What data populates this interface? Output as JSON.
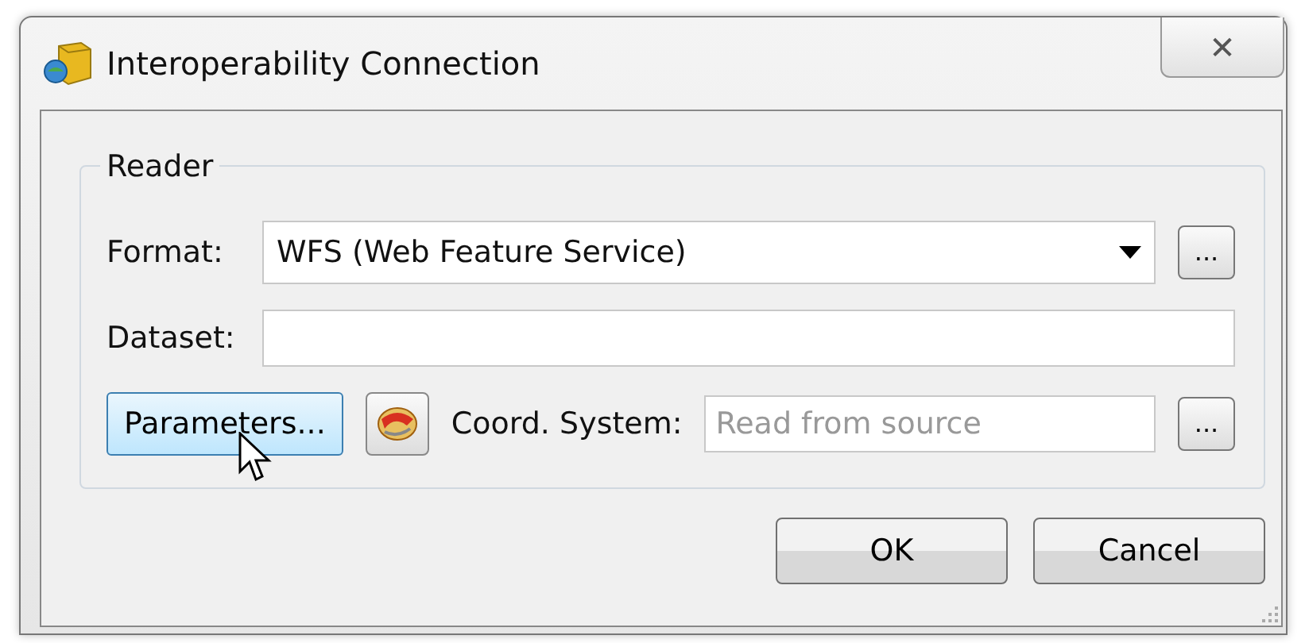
{
  "window": {
    "title": "Interoperability Connection",
    "close_label": "✕"
  },
  "reader": {
    "legend": "Reader",
    "format": {
      "label": "Format:",
      "value": "WFS (Web Feature Service)",
      "browse": "..."
    },
    "dataset": {
      "label": "Dataset:"
    },
    "parameters": {
      "label": "Parameters...",
      "hovered": true
    },
    "coord": {
      "label": "Coord. System:",
      "placeholder": "Read from source",
      "browse": "..."
    }
  },
  "buttons": [
    {
      "label": "OK"
    },
    {
      "label": "Cancel"
    }
  ]
}
